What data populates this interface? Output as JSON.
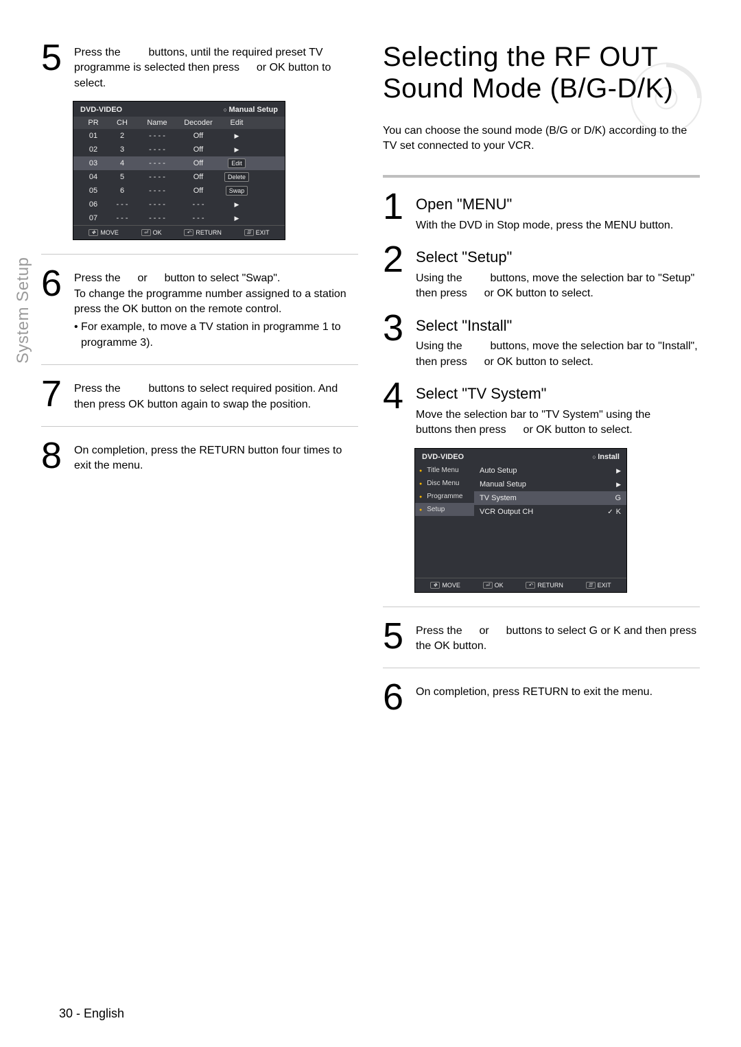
{
  "sidetab": "System Setup",
  "left": {
    "step5": {
      "line1": "Press the ",
      "line2": " buttons, until the required preset TV programme is selected then press ",
      "line3": " or OK button to select."
    },
    "osd1": {
      "title_l": "DVD-VIDEO",
      "title_r": "Manual Setup",
      "cols": [
        "PR",
        "CH",
        "Name",
        "Decoder",
        "Edit"
      ],
      "rows": [
        {
          "pr": "01",
          "ch": "2",
          "name": "- - - -",
          "dec": "Off",
          "edit": "▶"
        },
        {
          "pr": "02",
          "ch": "3",
          "name": "- - - -",
          "dec": "Off",
          "edit": "▶"
        },
        {
          "pr": "03",
          "ch": "4",
          "name": "- - - -",
          "dec": "Off",
          "edit": "Edit",
          "sel": true
        },
        {
          "pr": "04",
          "ch": "5",
          "name": "- - - -",
          "dec": "Off",
          "edit": "Delete"
        },
        {
          "pr": "05",
          "ch": "6",
          "name": "- - - -",
          "dec": "Off",
          "edit": "Swap"
        },
        {
          "pr": "06",
          "ch": "- - -",
          "name": "- - - -",
          "dec": "- - -",
          "edit": "▶"
        },
        {
          "pr": "07",
          "ch": "- - -",
          "name": "- - - -",
          "dec": "- - -",
          "edit": "▶"
        }
      ],
      "foot": [
        "MOVE",
        "OK",
        "RETURN",
        "EXIT"
      ]
    },
    "step6": {
      "l1": "Press the ",
      "l2": " or ",
      "l3": " button to select \"Swap\".",
      "l4": "To change the programme number assigned to a station press the OK button on the remote control.",
      "bullet": "• For example, to move a TV station in programme 1 to programme 3)."
    },
    "step7": {
      "l1": "Press the ",
      "l2": " buttons to select required position. And then press OK button again to swap the position."
    },
    "step8": {
      "txt": "On completion, press the RETURN button four times to exit the menu."
    }
  },
  "right": {
    "title1": "Selecting the RF OUT",
    "title2": "Sound Mode (B/G-D/K)",
    "intro": "You can choose the sound mode (B/G or D/K) according to the TV set connected to your VCR.",
    "s1": {
      "h": "Open \"MENU\"",
      "t": "With the DVD in Stop mode, press the MENU button."
    },
    "s2": {
      "h": "Select \"Setup\"",
      "t1": "Using the ",
      "t2": " buttons, move the selection bar to \"Setup\" then press ",
      "t3": " or OK button to select."
    },
    "s3": {
      "h": "Select \"Install\"",
      "t1": "Using the ",
      "t2": " buttons, move the selection bar to \"Install\", then press ",
      "t3": " or OK button to select."
    },
    "s4": {
      "h": "Select \"TV System\"",
      "t1": "Move the selection bar to \"TV System\" using the ",
      "t2": " buttons then press ",
      "t3": " or OK button to select."
    },
    "osd2": {
      "title_l": "DVD-VIDEO",
      "title_r": "Install",
      "side": [
        {
          "n": "Title Menu"
        },
        {
          "n": "Disc Menu"
        },
        {
          "n": "Programme"
        },
        {
          "n": "Setup",
          "sel": true
        }
      ],
      "rows": [
        {
          "l": "Auto Setup",
          "r": "▶"
        },
        {
          "l": "Manual Setup",
          "r": "▶"
        },
        {
          "l": "TV System",
          "r": "G",
          "sel": true
        },
        {
          "l": "VCR Output CH",
          "r": "K",
          "tick": true
        }
      ],
      "foot": [
        "MOVE",
        "OK",
        "RETURN",
        "EXIT"
      ]
    },
    "s5": {
      "t1": "Press the ",
      "t2": " or ",
      "t3": " buttons to select G or K and then press the OK button."
    },
    "s6": {
      "txt": "On completion, press RETURN to exit the menu."
    }
  },
  "footer": {
    "page": "30",
    "sep": " - ",
    "lang": "English"
  }
}
